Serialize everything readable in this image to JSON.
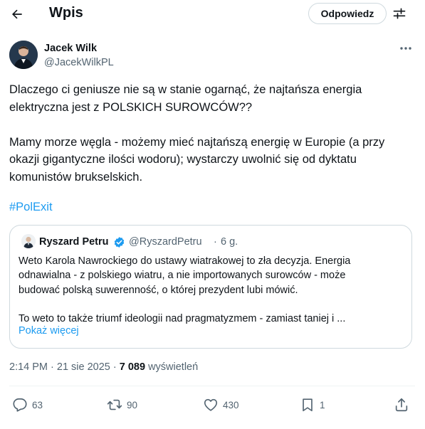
{
  "header": {
    "title": "Wpis",
    "reply_button": "Odpowiedz"
  },
  "author": {
    "name": "Jacek Wilk",
    "handle": "@JacekWilkPL"
  },
  "tweet": {
    "line1": "Dlaczego ci geniusze nie są w stanie ogarnąć, że najtańsza energia",
    "line2": "elektryczna jest z POLSKICH SUROWCÓW??",
    "line3": "Mamy morze węgla - możemy mieć najtańszą energię w Europie (a przy",
    "line4": "okazji gigantyczne ilości wodoru); wystarczy uwolnić się od dyktatu",
    "line5": "komunistów brukselskich.",
    "hashtag": "#PolExit"
  },
  "quote": {
    "name": "Ryszard Petru",
    "handle": "@RyszardPetru",
    "separator": "·",
    "time": "6 g.",
    "line1": "Weto Karola Nawrockiego do ustawy wiatrakowej to zła decyzja. Energia",
    "line2": "odnawialna - z polskiego wiatru, a nie importowanych surowców - może",
    "line3": "budować polską suwerenność, o której prezydent lubi mówić.",
    "line4": "To weto to także triumf ideologii nad pragmatyzmem - zamiast taniej i ...",
    "show_more": "Pokaż więcej",
    "verified_color": "#1d9bf0"
  },
  "meta": {
    "datetime": "2:14 PM · 21 sie 2025 · ",
    "views": "7 089",
    "views_label": " wyświetleń"
  },
  "actions": {
    "replies": "63",
    "reposts": "90",
    "likes": "430",
    "bookmarks": "1"
  },
  "colors": {
    "accent": "#1d9bf0",
    "text": "#0f1419",
    "secondary": "#536471",
    "border": "#cfd9de"
  }
}
